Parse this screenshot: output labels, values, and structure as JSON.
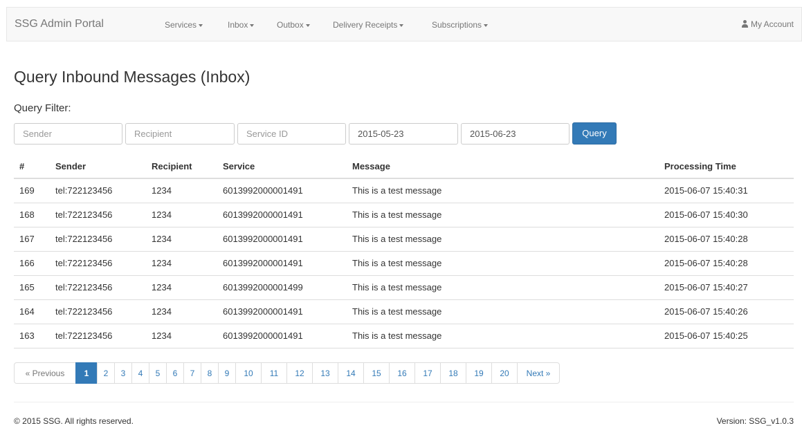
{
  "navbar": {
    "brand": "SSG Admin Portal",
    "items": [
      {
        "label": "Services"
      },
      {
        "label": "Inbox"
      },
      {
        "label": "Outbox"
      },
      {
        "label": "Delivery Receipts"
      },
      {
        "label": "Subscriptions"
      }
    ],
    "account_label": "My Account",
    "account_icon": "user-icon"
  },
  "page": {
    "title": "Query Inbound Messages (Inbox)",
    "filter_label": "Query Filter:"
  },
  "filters": {
    "sender_placeholder": "Sender",
    "recipient_placeholder": "Recipient",
    "service_placeholder": "Service ID",
    "start_date": "2015-05-23",
    "end_date": "2015-06-23",
    "query_label": "Query"
  },
  "table": {
    "headers": [
      "#",
      "Sender",
      "Recipient",
      "Service",
      "Message",
      "Processing Time"
    ],
    "rows": [
      [
        "169",
        "tel:722123456",
        "1234",
        "6013992000001491",
        "This is a test message",
        "2015-06-07 15:40:31"
      ],
      [
        "168",
        "tel:722123456",
        "1234",
        "6013992000001491",
        "This is a test message",
        "2015-06-07 15:40:30"
      ],
      [
        "167",
        "tel:722123456",
        "1234",
        "6013992000001491",
        "This is a test message",
        "2015-06-07 15:40:28"
      ],
      [
        "166",
        "tel:722123456",
        "1234",
        "6013992000001491",
        "This is a test message",
        "2015-06-07 15:40:28"
      ],
      [
        "165",
        "tel:722123456",
        "1234",
        "6013992000001499",
        "This is a test message",
        "2015-06-07 15:40:27"
      ],
      [
        "164",
        "tel:722123456",
        "1234",
        "6013992000001491",
        "This is a test message",
        "2015-06-07 15:40:26"
      ],
      [
        "163",
        "tel:722123456",
        "1234",
        "6013992000001491",
        "This is a test message",
        "2015-06-07 15:40:25"
      ]
    ]
  },
  "pagination": {
    "previous_label": "« Previous",
    "pages": [
      "1",
      "2",
      "3",
      "4",
      "5",
      "6",
      "7",
      "8",
      "9",
      "10",
      "11",
      "12",
      "13",
      "14",
      "15",
      "16",
      "17",
      "18",
      "19",
      "20"
    ],
    "active_page": "1",
    "next_label": "Next »"
  },
  "footer": {
    "copyright": "© 2015 SSG. All rights reserved.",
    "version": "Version: SSG_v1.0.3"
  },
  "colors": {
    "primary": "#337ab7",
    "navbar_bg": "#f8f8f8",
    "text": "#333333",
    "muted": "#777777"
  }
}
